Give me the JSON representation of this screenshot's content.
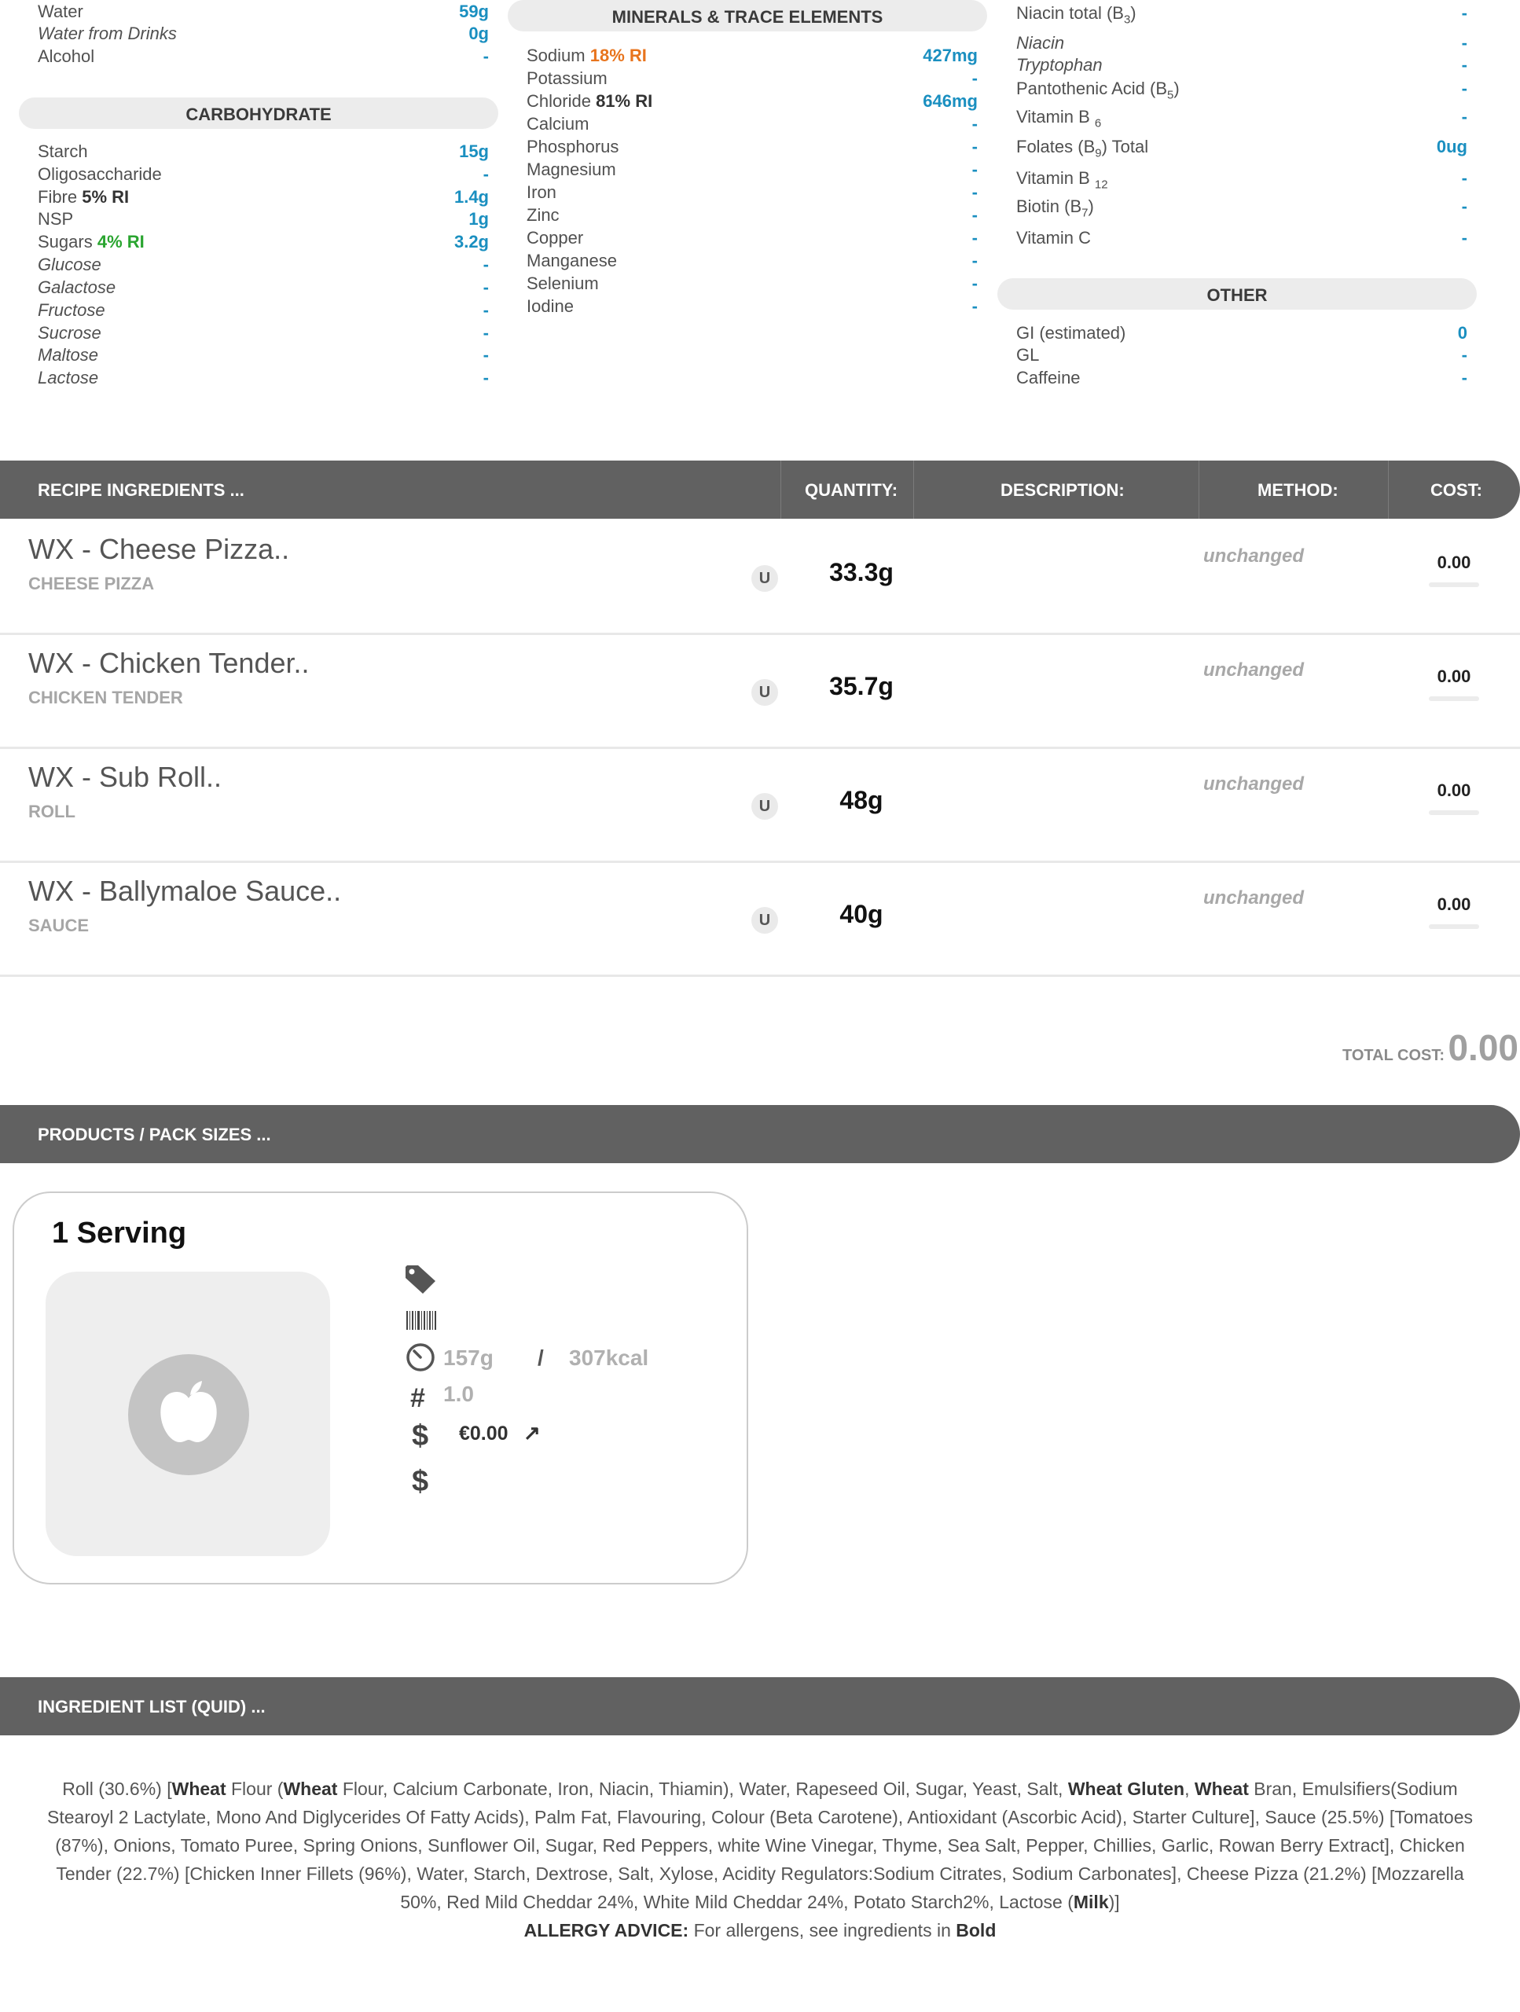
{
  "col1": {
    "rows_top": [
      {
        "name": "Water",
        "value": "59g",
        "italic": false
      },
      {
        "name": "Water from Drinks",
        "value": "0g",
        "italic": true
      },
      {
        "name": "Alcohol",
        "value": "-",
        "italic": false
      }
    ],
    "carb_header": "CARBOHYDRATE",
    "carb_rows": [
      {
        "name": "Starch",
        "ri": "",
        "value": "15g",
        "italic": false
      },
      {
        "name": "Oligosaccharide",
        "ri": "",
        "value": "-",
        "italic": false
      },
      {
        "name": "Fibre",
        "ri": "5% RI",
        "value": "1.4g",
        "italic": false
      },
      {
        "name": "NSP",
        "ri": "",
        "value": "1g",
        "italic": false
      },
      {
        "name": "Sugars",
        "ri": "4% RI",
        "value": "3.2g",
        "italic": false
      },
      {
        "name": "Glucose",
        "ri": "",
        "value": "-",
        "italic": true
      },
      {
        "name": "Galactose",
        "ri": "",
        "value": "-",
        "italic": true
      },
      {
        "name": "Fructose",
        "ri": "",
        "value": "-",
        "italic": true
      },
      {
        "name": "Sucrose",
        "ri": "",
        "value": "-",
        "italic": true
      },
      {
        "name": "Maltose",
        "ri": "",
        "value": "-",
        "italic": true
      },
      {
        "name": "Lactose",
        "ri": "",
        "value": "-",
        "italic": true
      }
    ]
  },
  "col2": {
    "header": "MINERALS & TRACE ELEMENTS",
    "rows": [
      {
        "name": "Sodium",
        "ri": "18% RI",
        "value": "427mg"
      },
      {
        "name": "Potassium",
        "ri": "",
        "value": "-"
      },
      {
        "name": "Chloride",
        "ri": "81% RI",
        "value": "646mg"
      },
      {
        "name": "Calcium",
        "ri": "",
        "value": "-"
      },
      {
        "name": "Phosphorus",
        "ri": "",
        "value": "-"
      },
      {
        "name": "Magnesium",
        "ri": "",
        "value": "-"
      },
      {
        "name": "Iron",
        "ri": "",
        "value": "-"
      },
      {
        "name": "Zinc",
        "ri": "",
        "value": "-"
      },
      {
        "name": "Copper",
        "ri": "",
        "value": "-"
      },
      {
        "name": "Manganese",
        "ri": "",
        "value": "-"
      },
      {
        "name": "Selenium",
        "ri": "",
        "value": "-"
      },
      {
        "name": "Iodine",
        "ri": "",
        "value": "-"
      }
    ]
  },
  "col3": {
    "rows": [
      {
        "name": "Niacin total (B",
        "sub": "3",
        "tail": ")",
        "value": "-",
        "italic": false
      },
      {
        "name": "Niacin",
        "sub": "",
        "tail": "",
        "value": "-",
        "italic": true
      },
      {
        "name": "Tryptophan",
        "sub": "",
        "tail": "",
        "value": "-",
        "italic": true
      },
      {
        "name": "Pantothenic Acid (B",
        "sub": "5",
        "tail": ")",
        "value": "-",
        "italic": false
      },
      {
        "name": "Vitamin B ",
        "sub": "6",
        "tail": "",
        "value": "-",
        "italic": false
      },
      {
        "name": "Folates (B",
        "sub": "9",
        "tail": ") Total",
        "value": "0ug",
        "italic": false
      },
      {
        "name": "Vitamin B ",
        "sub": "12",
        "tail": "",
        "value": "-",
        "italic": false
      },
      {
        "name": "Biotin (B",
        "sub": "7",
        "tail": ")",
        "value": "-",
        "italic": false
      },
      {
        "name": "Vitamin C",
        "sub": "",
        "tail": "",
        "value": "-",
        "italic": false
      }
    ],
    "other_header": "OTHER",
    "other_rows": [
      {
        "name": "GI (estimated)",
        "value": "0"
      },
      {
        "name": "GL",
        "value": "-"
      },
      {
        "name": "Caffeine",
        "value": "-"
      }
    ]
  },
  "recipe": {
    "header": {
      "ingredients": "RECIPE INGREDIENTS ...",
      "quantity": "QUANTITY:",
      "description": "DESCRIPTION:",
      "method": "METHOD:",
      "cost": "COST:"
    },
    "items": [
      {
        "title": "WX - Cheese Pizza..",
        "sub": "CHEESE PIZZA",
        "unit": "U",
        "qty": "33.3g",
        "method": "unchanged",
        "cost": "0.00"
      },
      {
        "title": "WX - Chicken Tender..",
        "sub": "CHICKEN TENDER",
        "unit": "U",
        "qty": "35.7g",
        "method": "unchanged",
        "cost": "0.00"
      },
      {
        "title": "WX - Sub Roll..",
        "sub": "ROLL",
        "unit": "U",
        "qty": "48g",
        "method": "unchanged",
        "cost": "0.00"
      },
      {
        "title": "WX - Ballymaloe Sauce..",
        "sub": "SAUCE",
        "unit": "U",
        "qty": "40g",
        "method": "unchanged",
        "cost": "0.00"
      }
    ],
    "total_label": "TOTAL COST:",
    "total_value": "0.00"
  },
  "products": {
    "header": "PRODUCTS / PACK SIZES ...",
    "card": {
      "title": "1 Serving",
      "weight": "157g",
      "separator": "/",
      "energy": "307kcal",
      "count_symbol": "#",
      "count": "1.0",
      "currency_symbol": "$",
      "price": "€0.00",
      "price_arrow": "↗",
      "currency_symbol_2": "$"
    }
  },
  "quid": {
    "header": "INGREDIENT LIST (QUID) ...",
    "segments": [
      {
        "t": "Roll (30.6%) [",
        "b": false
      },
      {
        "t": "Wheat",
        "b": true
      },
      {
        "t": " Flour (",
        "b": false
      },
      {
        "t": "Wheat",
        "b": true
      },
      {
        "t": " Flour, Calcium Carbonate, Iron, Niacin, Thiamin), Water, Rapeseed Oil, Sugar, Yeast, Salt, ",
        "b": false
      },
      {
        "t": "Wheat Gluten",
        "b": true
      },
      {
        "t": ", ",
        "b": false
      },
      {
        "t": "Wheat",
        "b": true
      },
      {
        "t": " Bran, Emulsifiers(Sodium Stearoyl 2 Lactylate, Mono And Diglycerides Of Fatty Acids), Palm Fat, Flavouring, Colour (Beta Carotene), Antioxidant (Ascorbic Acid), Starter Culture], Sauce (25.5%) [Tomatoes (87%), Onions, Tomato Puree, Spring Onions, Sunflower Oil, Sugar, Red Peppers, white Wine Vinegar, Thyme, Sea Salt, Pepper, Chillies, Garlic, Rowan Berry Extract], Chicken Tender (22.7%) [Chicken Inner Fillets (96%), Water, Starch, Dextrose, Salt, Xylose, Acidity Regulators:Sodium Citrates, Sodium Carbonates], Cheese Pizza (21.2%) [Mozzarella 50%, Red Mild Cheddar 24%, White Mild Cheddar 24%, Potato Starch2%, Lactose (",
        "b": false
      },
      {
        "t": "Milk",
        "b": true
      },
      {
        "t": ")]",
        "b": false
      }
    ],
    "advice_label": "ALLERGY ADVICE:",
    "advice_text": " For allergens, see ingredients in ",
    "advice_bold": "Bold"
  }
}
